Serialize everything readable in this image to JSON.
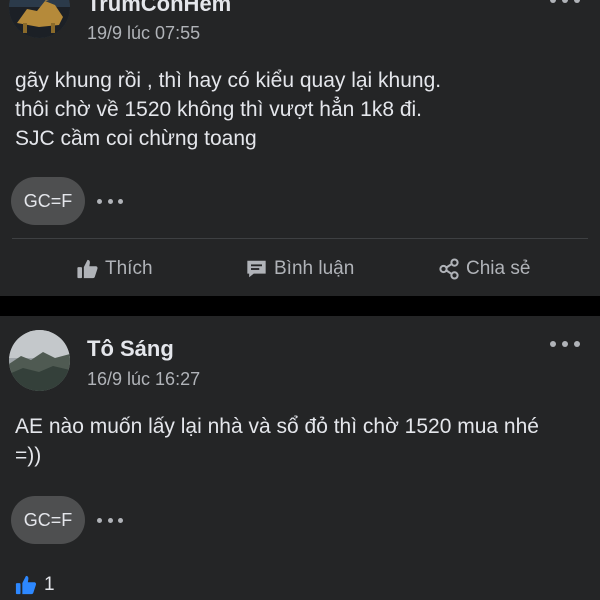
{
  "posts": [
    {
      "author": "TrumConHem",
      "timestamp": "19/9 lúc 07:55",
      "lines": [
        "gãy khung rồi , thì hay có kiểu quay lại khung.",
        "thôi chờ về 1520 không thì vượt hẳn 1k8 đi.",
        "SJC cầm coi chừng toang"
      ],
      "reaction_label": "GC=F"
    },
    {
      "author": "Tô Sáng",
      "timestamp": "16/9 lúc 16:27",
      "lines": [
        "AE nào muốn lấy lại nhà và sổ đỏ thì chờ 1520 mua nhé",
        "=))"
      ],
      "reaction_label": "GC=F",
      "like_count": "1"
    }
  ],
  "actions": {
    "like": "Thích",
    "comment": "Bình luận",
    "share": "Chia sẻ"
  },
  "icons": [
    "thumbs-up-icon",
    "comment-icon",
    "share-icon",
    "more-icon"
  ],
  "colors": {
    "background": "#000000",
    "card": "#242526",
    "text": "#e4e6eb",
    "muted": "#b0b3b8",
    "pill": "#4e4f50",
    "like_blue": "#2d88ff"
  }
}
